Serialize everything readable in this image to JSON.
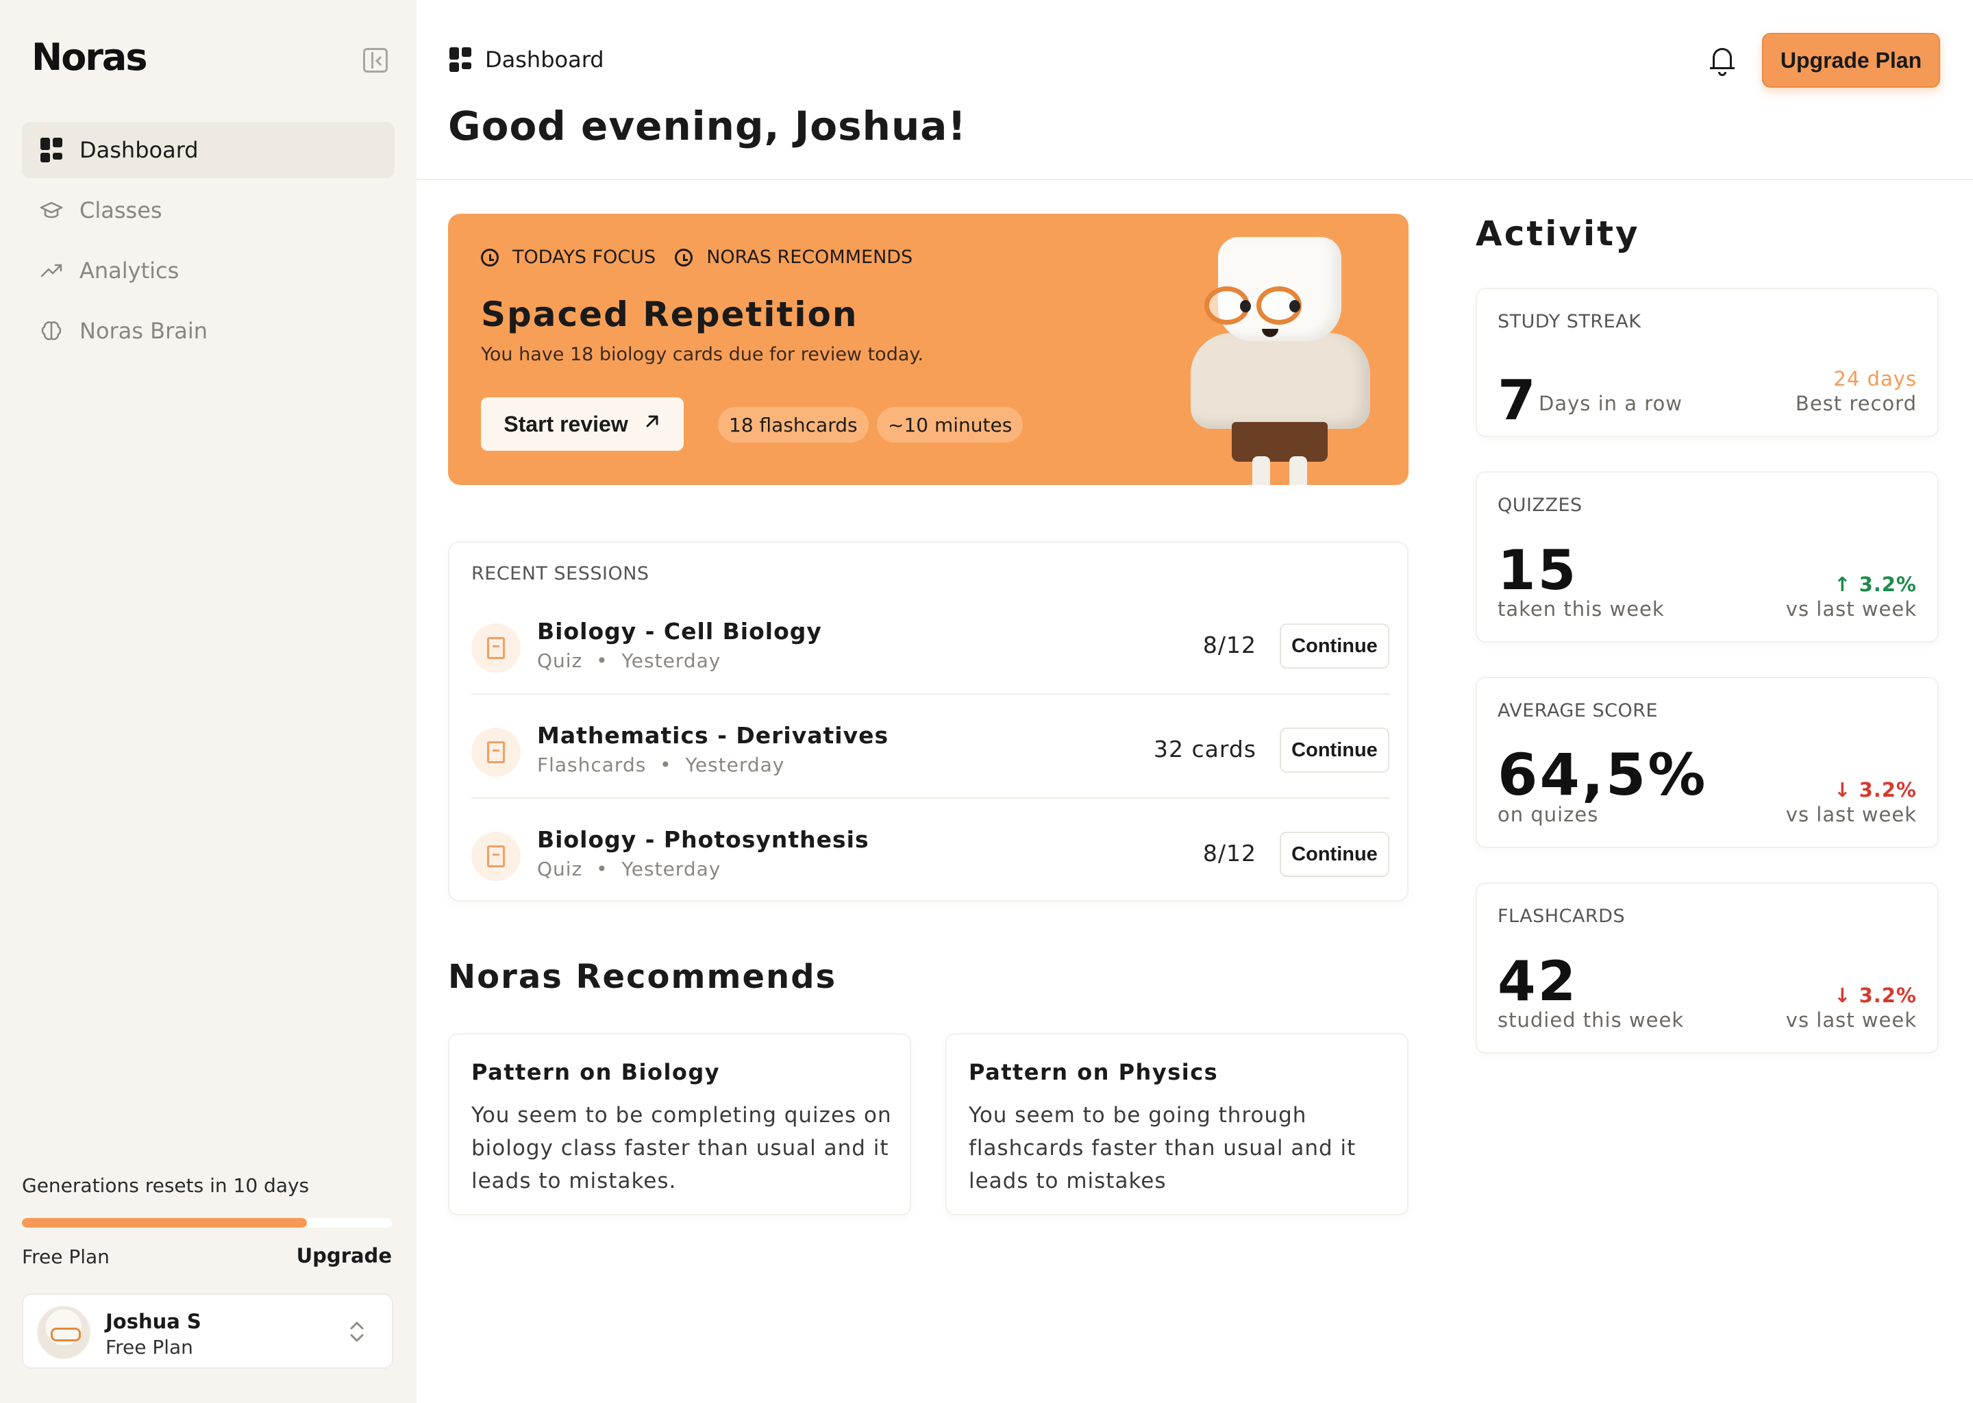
{
  "app": {
    "logo": "Noras"
  },
  "sidebar": {
    "items": [
      {
        "label": "Dashboard",
        "icon": "dashboard-grid-icon",
        "active": true
      },
      {
        "label": "Classes",
        "icon": "graduation-cap-icon",
        "active": false
      },
      {
        "label": "Analytics",
        "icon": "trend-up-icon",
        "active": false
      },
      {
        "label": "Noras Brain",
        "icon": "brain-icon",
        "active": false
      }
    ],
    "usage": {
      "label": "Generations resets in 10 days",
      "progress_percent": 77
    },
    "plan": {
      "label": "Free Plan",
      "upgrade_label": "Upgrade"
    },
    "user": {
      "name": "Joshua S",
      "plan": "Free Plan"
    }
  },
  "header": {
    "breadcrumb": "Dashboard",
    "upgrade_button": "Upgrade Plan",
    "greeting": "Good evening, Joshua!"
  },
  "focus": {
    "tag1": "TODAYS FOCUS",
    "tag2": "NORAS RECOMMENDS",
    "title": "Spaced Repetition",
    "subtitle": "You have 18 biology cards due for review today.",
    "button": "Start review",
    "chip1": "18 flashcards",
    "chip2": "~10 minutes",
    "accent": "#f89f57"
  },
  "sessions": {
    "label": "RECENT SESSIONS",
    "rows": [
      {
        "title": "Biology - Cell Biology",
        "type": "Quiz",
        "when": "Yesterday",
        "count": "8/12",
        "button": "Continue"
      },
      {
        "title": "Mathematics - Derivatives",
        "type": "Flashcards",
        "when": "Yesterday",
        "count": "32 cards",
        "button": "Continue"
      },
      {
        "title": "Biology - Photosynthesis",
        "type": "Quiz",
        "when": "Yesterday",
        "count": "8/12",
        "button": "Continue"
      }
    ]
  },
  "recommends": {
    "heading": "Noras Recommends",
    "cards": [
      {
        "title": "Pattern on Biology",
        "body": "You seem to be completing quizes on biology class faster than usual and it leads to mistakes."
      },
      {
        "title": "Pattern on Physics",
        "body": "You seem to be going through flashcards faster than usual and it leads to mistakes"
      }
    ]
  },
  "activity": {
    "heading": "Activity",
    "streak": {
      "label": "STUDY STREAK",
      "value": "7",
      "unit": "Days in a row",
      "best": "24 days",
      "best_label": "Best record"
    },
    "quizzes": {
      "label": "QUIZZES",
      "value": "15",
      "sub": "taken this week",
      "delta": "3.2%",
      "direction": "up",
      "note": "vs last week"
    },
    "average": {
      "label": "AVERAGE SCORE",
      "value": "64,5%",
      "sub": "on quizes",
      "delta": "3.2%",
      "direction": "down",
      "note": "vs last week"
    },
    "flashcards": {
      "label": "FLASHCARDS",
      "value": "42",
      "sub": "studied this week",
      "delta": "3.2%",
      "direction": "down",
      "note": "vs last week"
    }
  }
}
